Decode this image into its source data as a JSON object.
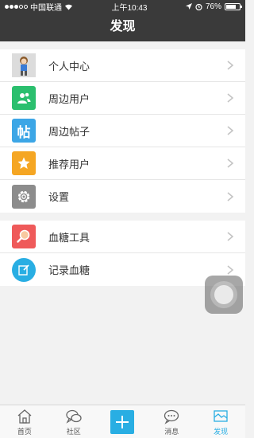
{
  "status": {
    "carrier": "中国联通",
    "time": "上午10:43",
    "battery": "76%",
    "battery_level": 0.76
  },
  "header": {
    "title": "发现"
  },
  "section1": [
    {
      "label": "个人中心",
      "icon": "avatar-image",
      "color": "#c9c9c9"
    },
    {
      "label": "周边用户",
      "icon": "users-icon",
      "color": "#2bbf6e"
    },
    {
      "label": "周边帖子",
      "icon": "post-icon",
      "color": "#3ca6e6",
      "icon_text": "帖"
    },
    {
      "label": "推荐用户",
      "icon": "star-icon",
      "color": "#f5a623"
    },
    {
      "label": "设置",
      "icon": "gear-icon",
      "color": "#8c8c8c"
    }
  ],
  "section2": [
    {
      "label": "血糖工具",
      "icon": "magnifier-icon",
      "color": "#ef5a5a"
    },
    {
      "label": "记录血糖",
      "icon": "edit-icon",
      "color": "#29aee3"
    }
  ],
  "tabs": [
    {
      "label": "首页",
      "icon": "home-icon"
    },
    {
      "label": "社区",
      "icon": "chat-icon"
    },
    {
      "label": "",
      "icon": "plus-icon"
    },
    {
      "label": "消息",
      "icon": "message-icon"
    },
    {
      "label": "发现",
      "icon": "discover-icon",
      "active": true
    }
  ]
}
